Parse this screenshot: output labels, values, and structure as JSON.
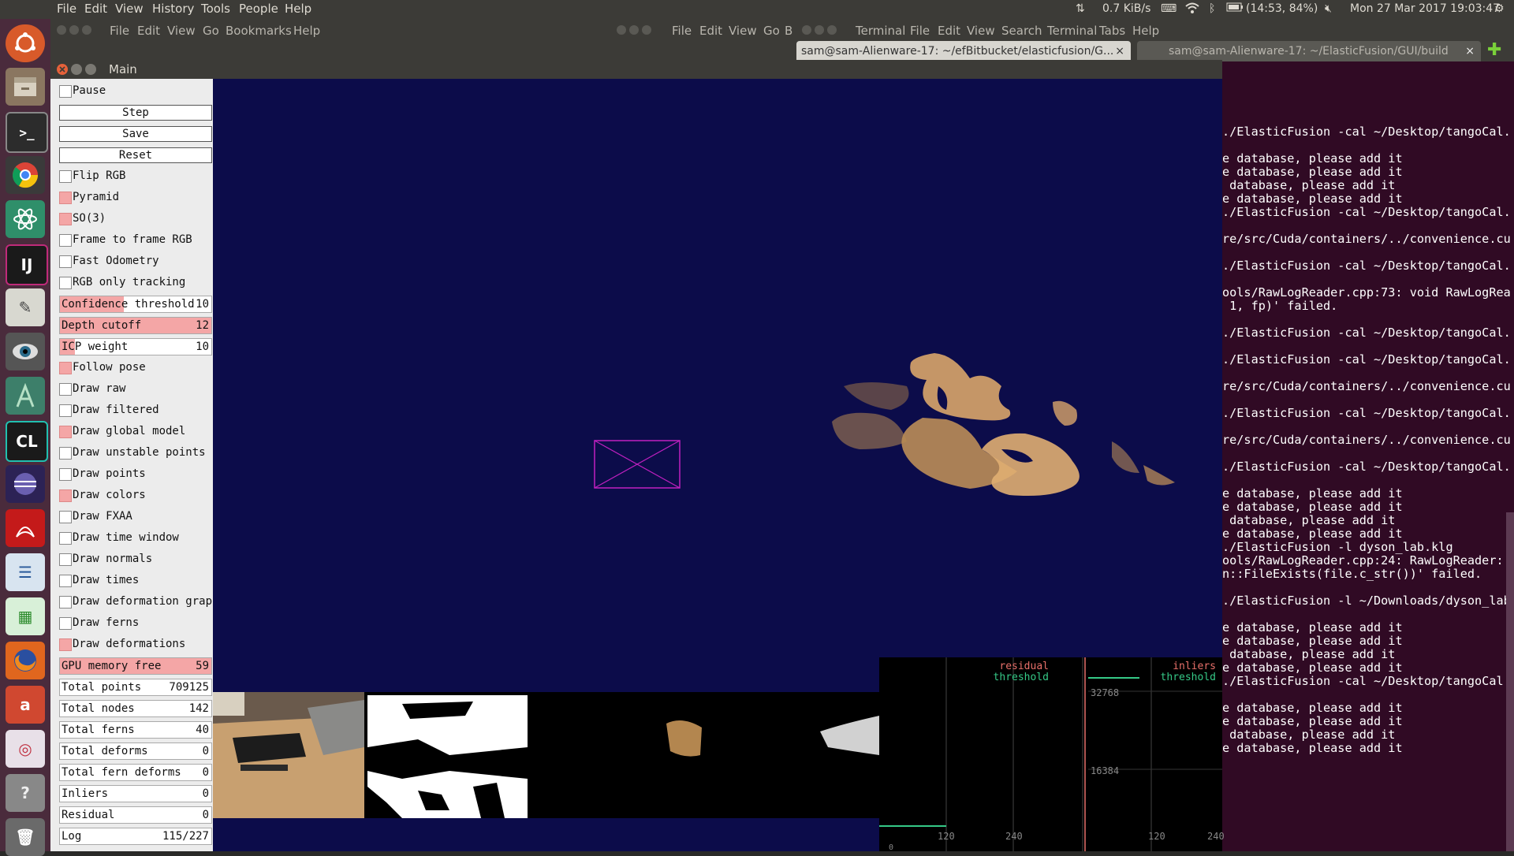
{
  "topbar": {
    "menus": [
      "File",
      "Edit",
      "View",
      "History",
      "Tools",
      "People",
      "Help"
    ],
    "net_speed": "0.7 KiB/s",
    "battery": "(14:53, 84%)",
    "datetime": "Mon 27 Mar 2017 19:03:47"
  },
  "bg_window_files": {
    "menus": [
      "File",
      "Edit",
      "View",
      "Go",
      "Bookmarks",
      "Help"
    ]
  },
  "bg_window_terminal": {
    "menus": [
      "File",
      "Edit",
      "View",
      "Go",
      "B",
      "Terminal",
      "File",
      "Edit",
      "View",
      "Search",
      "Terminal",
      "Tabs",
      "Help"
    ],
    "tab1": "sam@sam-Alienware-17: ~/efBitbucket/elasticfusion/G...",
    "tab2": "sam@sam-Alienware-17: ~/ElasticFusion/GUI/build"
  },
  "terminal_lines": [
    "./ElasticFusion -cal ~/Desktop/tangoCal.",
    "",
    "e database, please add it",
    "e database, please add it",
    " database, please add it",
    "e database, please add it",
    "./ElasticFusion -cal ~/Desktop/tangoCal.",
    "",
    "re/src/Cuda/containers/../convenience.cu",
    "",
    "./ElasticFusion -cal ~/Desktop/tangoCal.",
    "",
    "ools/RawLogReader.cpp:73: void RawLogRea",
    " 1, fp)' failed.",
    "",
    "./ElasticFusion -cal ~/Desktop/tangoCal.",
    "",
    "./ElasticFusion -cal ~/Desktop/tangoCal.",
    "",
    "re/src/Cuda/containers/../convenience.cu",
    "",
    "./ElasticFusion -cal ~/Desktop/tangoCal.",
    "",
    "re/src/Cuda/containers/../convenience.cu",
    "",
    "./ElasticFusion -cal ~/Desktop/tangoCal.",
    "",
    "e database, please add it",
    "e database, please add it",
    " database, please add it",
    "e database, please add it",
    "./ElasticFusion -l dyson_lab.klg",
    "ools/RawLogReader.cpp:24: RawLogReader::",
    "n::FileExists(file.c_str())' failed.",
    "",
    "./ElasticFusion -l ~/Downloads/dyson_lab",
    "",
    "e database, please add it",
    "e database, please add it",
    " database, please add it",
    "e database, please add it",
    "./ElasticFusion -cal ~/Desktop/tangoCal.",
    "",
    "e database, please add it",
    "e database, please add it",
    " database, please add it",
    "e database, please add it"
  ],
  "main": {
    "title": "Main",
    "controls": [
      {
        "kind": "check",
        "label": "Pause",
        "on": false
      },
      {
        "kind": "button",
        "label": "Step"
      },
      {
        "kind": "button",
        "label": "Save"
      },
      {
        "kind": "button",
        "label": "Reset"
      },
      {
        "kind": "check",
        "label": "Flip RGB",
        "on": false
      },
      {
        "kind": "check",
        "label": "Pyramid",
        "on": true
      },
      {
        "kind": "check",
        "label": "SO(3)",
        "on": true
      },
      {
        "kind": "check",
        "label": "Frame to frame RGB",
        "on": false
      },
      {
        "kind": "check",
        "label": "Fast Odometry",
        "on": false
      },
      {
        "kind": "check",
        "label": "RGB only tracking",
        "on": false
      },
      {
        "kind": "slider",
        "label": "Confidence threshold",
        "value": "10",
        "fill": 0.42
      },
      {
        "kind": "slider",
        "label": "Depth cutoff",
        "value": "12",
        "fill": 1.0
      },
      {
        "kind": "slider",
        "label": "ICP weight",
        "value": "10",
        "fill": 0.1
      },
      {
        "kind": "check",
        "label": "Follow pose",
        "on": true
      },
      {
        "kind": "check",
        "label": "Draw raw",
        "on": false
      },
      {
        "kind": "check",
        "label": "Draw filtered",
        "on": false
      },
      {
        "kind": "check",
        "label": "Draw global model",
        "on": true
      },
      {
        "kind": "check",
        "label": "Draw unstable points",
        "on": false
      },
      {
        "kind": "check",
        "label": "Draw points",
        "on": false
      },
      {
        "kind": "check",
        "label": "Draw colors",
        "on": true
      },
      {
        "kind": "check",
        "label": "Draw FXAA",
        "on": false
      },
      {
        "kind": "check",
        "label": "Draw time window",
        "on": false
      },
      {
        "kind": "check",
        "label": "Draw normals",
        "on": false
      },
      {
        "kind": "check",
        "label": "Draw times",
        "on": false
      },
      {
        "kind": "check",
        "label": "Draw deformation graph",
        "on": false
      },
      {
        "kind": "check",
        "label": "Draw ferns",
        "on": false
      },
      {
        "kind": "check",
        "label": "Draw deformations",
        "on": true
      },
      {
        "kind": "slider",
        "label": "GPU memory free",
        "value": "59",
        "fill": 1.0
      },
      {
        "kind": "value",
        "label": "Total points",
        "value": "709125"
      },
      {
        "kind": "value",
        "label": "Total nodes",
        "value": "142"
      },
      {
        "kind": "value",
        "label": "Total ferns",
        "value": "40"
      },
      {
        "kind": "value",
        "label": "Total deforms",
        "value": "0"
      },
      {
        "kind": "value",
        "label": "Total fern deforms",
        "value": "0"
      },
      {
        "kind": "value",
        "label": "Inliers",
        "value": "0"
      },
      {
        "kind": "value",
        "label": "Residual",
        "value": "0"
      },
      {
        "kind": "value",
        "label": "Log",
        "value": "115/227"
      }
    ],
    "graph": {
      "residual_label": "residual",
      "residual_threshold_label": "threshold",
      "inliers_label": "inliers",
      "inliers_threshold_label": "threshold",
      "ytick_1": "32768",
      "ytick_2": "16384",
      "xticks_left": [
        "120",
        "240"
      ],
      "xticks_right": [
        "120",
        "240"
      ],
      "zero_label": "0",
      "residual_color": "#e8706a",
      "threshold_color": "#35c987"
    }
  },
  "colors": {
    "scene_bg": "#0c0c4a",
    "camera_frustum": "#c020c0",
    "reconstruction": "#d9a56a"
  }
}
